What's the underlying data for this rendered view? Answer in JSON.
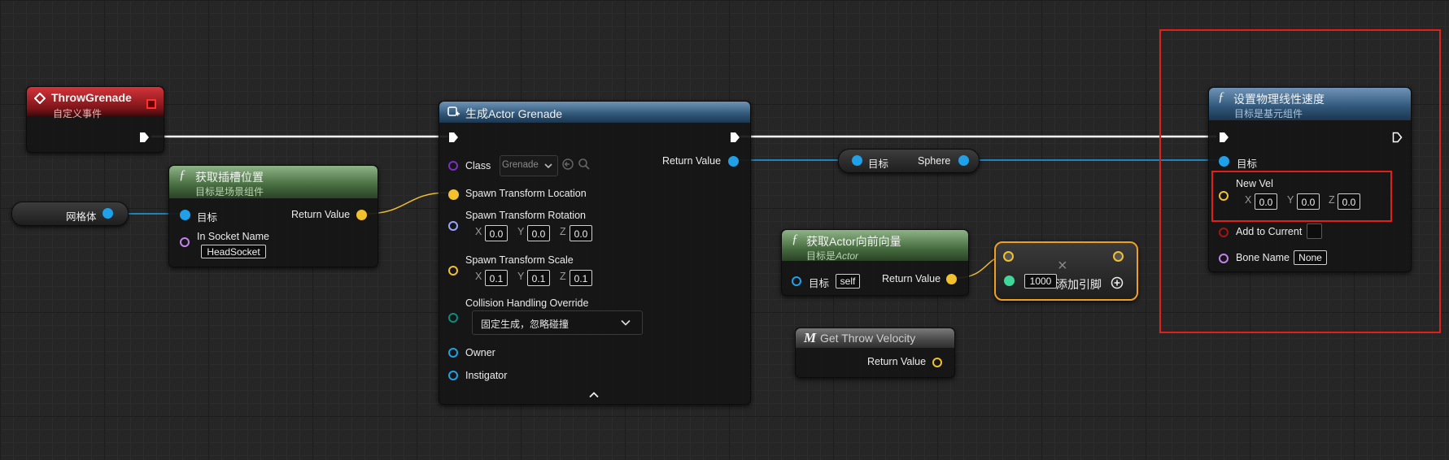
{
  "colors": {
    "exec": "#ffffff",
    "object": "#1fa0e8",
    "vector": "#f2c12e",
    "rotator": "#9aa3ff",
    "name": "#c583f0",
    "class": "#7b2fc5",
    "enum": "#0d8a7c",
    "bool": "#a81313",
    "float": "#3fd79a",
    "highlight": "#e0201b"
  },
  "throw_event": {
    "title": "ThrowGrenade",
    "subtitle": "自定义事件",
    "icon": "event-diamond-icon"
  },
  "mesh_var": {
    "label": "网格体"
  },
  "socket_node": {
    "title": "获取插槽位置",
    "subtitle": "目标是场景组件",
    "target_label": "目标",
    "socket_name_label": "In Socket Name",
    "socket_name_value": "HeadSocket",
    "return_label": "Return Value"
  },
  "spawn_node": {
    "title": "生成Actor Grenade",
    "class_label": "Class",
    "class_value": "Grenade",
    "location_label": "Spawn Transform Location",
    "rotation_label": "Spawn Transform Rotation",
    "rotation": {
      "x": "0.0",
      "y": "0.0",
      "z": "0.0"
    },
    "scale_label": "Spawn Transform Scale",
    "scale": {
      "x": "0.1",
      "y": "0.1",
      "z": "0.1"
    },
    "collision_label": "Collision Handling Override",
    "collision_value": "固定生成，忽略碰撞",
    "owner_label": "Owner",
    "instigator_label": "Instigator",
    "return_label": "Return Value"
  },
  "sphere_var": {
    "target_label": "目标",
    "value_label": "Sphere"
  },
  "forward_node": {
    "title": "获取Actor向前向量",
    "subtitle_prefix": "目标是",
    "subtitle_em": "Actor",
    "target_label": "目标",
    "target_value": "self",
    "return_label": "Return Value"
  },
  "multiply_node": {
    "value": "1000",
    "add_pin_label": "添加引脚",
    "symbol": "×"
  },
  "throw_velocity_node": {
    "title": "Get Throw Velocity",
    "return_label": "Return Value"
  },
  "velocity_node": {
    "title": "设置物理线性速度",
    "subtitle": "目标是基元组件",
    "target_label": "目标",
    "new_vel_label": "New Vel",
    "new_vel": {
      "x": "0.0",
      "y": "0.0",
      "z": "0.0"
    },
    "add_current_label": "Add to Current",
    "bone_name_label": "Bone Name",
    "bone_name_value": "None"
  },
  "axes": {
    "x": "X",
    "y": "Y",
    "z": "Z"
  }
}
